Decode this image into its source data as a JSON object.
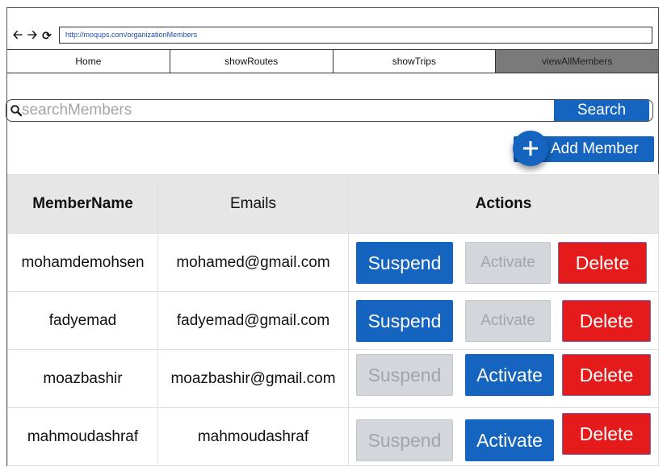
{
  "browser": {
    "url": "http://moqups.com/organizationMembers",
    "icons": [
      "back-arrow-icon",
      "forward-arrow-icon",
      "reload-icon"
    ]
  },
  "nav": {
    "tabs": [
      {
        "label": "Home",
        "active": false
      },
      {
        "label": "showRoutes",
        "active": false
      },
      {
        "label": "showTrips",
        "active": false
      },
      {
        "label": "viewAllMembers",
        "active": true
      }
    ]
  },
  "search": {
    "placeholder": "searchMembers",
    "value": "",
    "button_label": "Search"
  },
  "add_member": {
    "label": "Add Member",
    "icon": "plus-icon"
  },
  "table": {
    "headers": [
      "MemberName",
      "Emails",
      "Actions"
    ],
    "rows": [
      {
        "name": "mohamdemohsen",
        "email": "mohamed@gmail.com",
        "suspend": "Suspend",
        "activate": "Activate",
        "delete": "Delete",
        "suspend_enabled": true,
        "activate_enabled": false
      },
      {
        "name": "fadyemad",
        "email": "fadyemad@gmail.com",
        "suspend": "Suspend",
        "activate": "Activate",
        "delete": "Delete",
        "suspend_enabled": true,
        "activate_enabled": false
      },
      {
        "name": "moazbashir",
        "email": "moazbashir@gmail.com",
        "suspend": "Suspend",
        "activate": "Activate",
        "delete": "Delete",
        "suspend_enabled": false,
        "activate_enabled": true
      },
      {
        "name": "mahmoudashraf",
        "email": "mahmoudashraf",
        "suspend": "Suspend",
        "activate": "Activate",
        "delete": "Delete",
        "suspend_enabled": false,
        "activate_enabled": true
      }
    ]
  },
  "colors": {
    "primary": "#1565c0",
    "danger": "#e51b1b",
    "disabled": "#d3d7db",
    "active_tab": "#7a7a7a",
    "header_bg": "#e6e6e6"
  }
}
